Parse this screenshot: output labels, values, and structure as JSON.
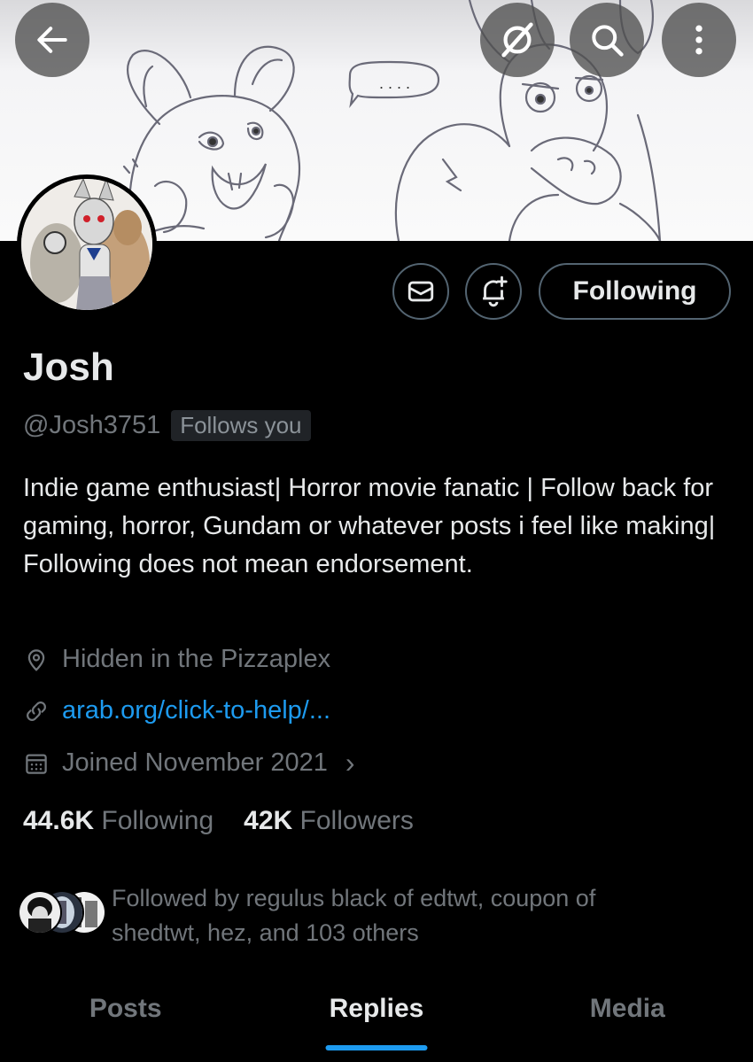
{
  "header": {
    "back_icon": "arrow-left-icon",
    "grok_icon": "grok-slash-icon",
    "search_icon": "search-icon",
    "more_icon": "more-vertical-icon"
  },
  "banner": {
    "speech_bubble": ". . . ."
  },
  "profile": {
    "name": "Josh",
    "handle": "@Josh3751",
    "follows_you": "Follows you",
    "bio": "Indie game enthusiast| Horror movie fanatic | Follow back for gaming, horror, Gundam or whatever posts i feel like making| Following does not mean endorsement.",
    "location": "Hidden in the Pizzaplex",
    "website": "arab.org/click-to-help/...",
    "joined": "Joined November 2021",
    "joined_chevron": "›"
  },
  "actions": {
    "message_icon": "mail-icon",
    "notify_icon": "bell-plus-icon",
    "following_label": "Following"
  },
  "stats": {
    "following_count": "44.6K",
    "following_label": "Following",
    "followers_count": "42K",
    "followers_label": "Followers"
  },
  "followed_by": {
    "text": "Followed by regulus black of edtwt, coupon of shedtwt, hez, and 103 others"
  },
  "tabs": [
    {
      "label": "Posts",
      "active": false
    },
    {
      "label": "Replies",
      "active": true
    },
    {
      "label": "Media",
      "active": false
    }
  ],
  "colors": {
    "background": "#000000",
    "text_primary": "#e7e9ea",
    "text_secondary": "#71767b",
    "accent": "#1d9bf0",
    "border": "#536471"
  }
}
